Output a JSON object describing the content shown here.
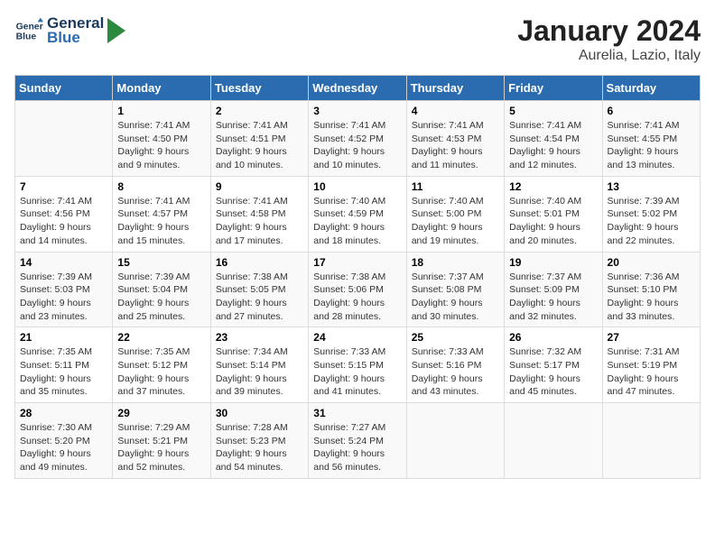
{
  "header": {
    "logo_line1": "General",
    "logo_line2": "Blue",
    "title": "January 2024",
    "subtitle": "Aurelia, Lazio, Italy"
  },
  "columns": [
    "Sunday",
    "Monday",
    "Tuesday",
    "Wednesday",
    "Thursday",
    "Friday",
    "Saturday"
  ],
  "weeks": [
    [
      {
        "day": "",
        "info": ""
      },
      {
        "day": "1",
        "info": "Sunrise: 7:41 AM\nSunset: 4:50 PM\nDaylight: 9 hours\nand 9 minutes."
      },
      {
        "day": "2",
        "info": "Sunrise: 7:41 AM\nSunset: 4:51 PM\nDaylight: 9 hours\nand 10 minutes."
      },
      {
        "day": "3",
        "info": "Sunrise: 7:41 AM\nSunset: 4:52 PM\nDaylight: 9 hours\nand 10 minutes."
      },
      {
        "day": "4",
        "info": "Sunrise: 7:41 AM\nSunset: 4:53 PM\nDaylight: 9 hours\nand 11 minutes."
      },
      {
        "day": "5",
        "info": "Sunrise: 7:41 AM\nSunset: 4:54 PM\nDaylight: 9 hours\nand 12 minutes."
      },
      {
        "day": "6",
        "info": "Sunrise: 7:41 AM\nSunset: 4:55 PM\nDaylight: 9 hours\nand 13 minutes."
      }
    ],
    [
      {
        "day": "7",
        "info": "Sunrise: 7:41 AM\nSunset: 4:56 PM\nDaylight: 9 hours\nand 14 minutes."
      },
      {
        "day": "8",
        "info": "Sunrise: 7:41 AM\nSunset: 4:57 PM\nDaylight: 9 hours\nand 15 minutes."
      },
      {
        "day": "9",
        "info": "Sunrise: 7:41 AM\nSunset: 4:58 PM\nDaylight: 9 hours\nand 17 minutes."
      },
      {
        "day": "10",
        "info": "Sunrise: 7:40 AM\nSunset: 4:59 PM\nDaylight: 9 hours\nand 18 minutes."
      },
      {
        "day": "11",
        "info": "Sunrise: 7:40 AM\nSunset: 5:00 PM\nDaylight: 9 hours\nand 19 minutes."
      },
      {
        "day": "12",
        "info": "Sunrise: 7:40 AM\nSunset: 5:01 PM\nDaylight: 9 hours\nand 20 minutes."
      },
      {
        "day": "13",
        "info": "Sunrise: 7:39 AM\nSunset: 5:02 PM\nDaylight: 9 hours\nand 22 minutes."
      }
    ],
    [
      {
        "day": "14",
        "info": "Sunrise: 7:39 AM\nSunset: 5:03 PM\nDaylight: 9 hours\nand 23 minutes."
      },
      {
        "day": "15",
        "info": "Sunrise: 7:39 AM\nSunset: 5:04 PM\nDaylight: 9 hours\nand 25 minutes."
      },
      {
        "day": "16",
        "info": "Sunrise: 7:38 AM\nSunset: 5:05 PM\nDaylight: 9 hours\nand 27 minutes."
      },
      {
        "day": "17",
        "info": "Sunrise: 7:38 AM\nSunset: 5:06 PM\nDaylight: 9 hours\nand 28 minutes."
      },
      {
        "day": "18",
        "info": "Sunrise: 7:37 AM\nSunset: 5:08 PM\nDaylight: 9 hours\nand 30 minutes."
      },
      {
        "day": "19",
        "info": "Sunrise: 7:37 AM\nSunset: 5:09 PM\nDaylight: 9 hours\nand 32 minutes."
      },
      {
        "day": "20",
        "info": "Sunrise: 7:36 AM\nSunset: 5:10 PM\nDaylight: 9 hours\nand 33 minutes."
      }
    ],
    [
      {
        "day": "21",
        "info": "Sunrise: 7:35 AM\nSunset: 5:11 PM\nDaylight: 9 hours\nand 35 minutes."
      },
      {
        "day": "22",
        "info": "Sunrise: 7:35 AM\nSunset: 5:12 PM\nDaylight: 9 hours\nand 37 minutes."
      },
      {
        "day": "23",
        "info": "Sunrise: 7:34 AM\nSunset: 5:14 PM\nDaylight: 9 hours\nand 39 minutes."
      },
      {
        "day": "24",
        "info": "Sunrise: 7:33 AM\nSunset: 5:15 PM\nDaylight: 9 hours\nand 41 minutes."
      },
      {
        "day": "25",
        "info": "Sunrise: 7:33 AM\nSunset: 5:16 PM\nDaylight: 9 hours\nand 43 minutes."
      },
      {
        "day": "26",
        "info": "Sunrise: 7:32 AM\nSunset: 5:17 PM\nDaylight: 9 hours\nand 45 minutes."
      },
      {
        "day": "27",
        "info": "Sunrise: 7:31 AM\nSunset: 5:19 PM\nDaylight: 9 hours\nand 47 minutes."
      }
    ],
    [
      {
        "day": "28",
        "info": "Sunrise: 7:30 AM\nSunset: 5:20 PM\nDaylight: 9 hours\nand 49 minutes."
      },
      {
        "day": "29",
        "info": "Sunrise: 7:29 AM\nSunset: 5:21 PM\nDaylight: 9 hours\nand 52 minutes."
      },
      {
        "day": "30",
        "info": "Sunrise: 7:28 AM\nSunset: 5:23 PM\nDaylight: 9 hours\nand 54 minutes."
      },
      {
        "day": "31",
        "info": "Sunrise: 7:27 AM\nSunset: 5:24 PM\nDaylight: 9 hours\nand 56 minutes."
      },
      {
        "day": "",
        "info": ""
      },
      {
        "day": "",
        "info": ""
      },
      {
        "day": "",
        "info": ""
      }
    ]
  ]
}
